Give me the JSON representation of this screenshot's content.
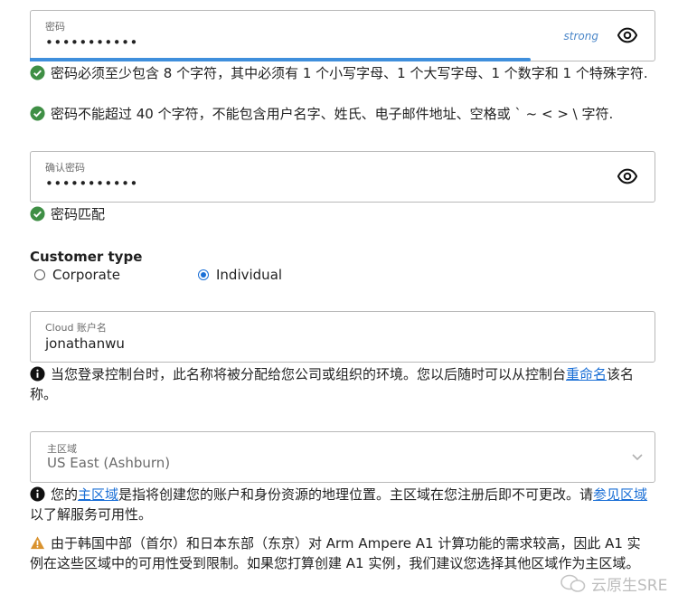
{
  "password": {
    "label": "密码",
    "value": "•••••••••••",
    "strength": "strong",
    "strength_fraction": 0.8,
    "rules": [
      "密码必须至少包含 8 个字符，其中必须有 1 个小写字母、1 个大写字母、1 个数字和 1 个特殊字符.",
      "密码不能超过 40 个字符，不能包含用户名字、姓氏、电子邮件地址、空格或 ` ~ < > \\ 字符."
    ]
  },
  "confirm_password": {
    "label": "确认密码",
    "value": "•••••••••••",
    "match_text": "密码匹配"
  },
  "customer_type": {
    "title": "Customer type",
    "options": [
      "Corporate",
      "Individual"
    ],
    "selected": "Individual"
  },
  "cloud_account": {
    "label": "Cloud 账户名",
    "value": "jonathanwu",
    "info_before": "当您登录控制台时，此名称将被分配给您公司或组织的环境。您以后随时可以从控制台",
    "info_link": "重命名",
    "info_after": "该名称。"
  },
  "home_region": {
    "label": "主区域",
    "value": "US East (Ashburn)",
    "info_p1": "您的",
    "info_link1": "主区域",
    "info_p2": "是指将创建您的账户和身份资源的地理位置。主区域在您注册后即不可更改。请",
    "info_link2": "参见区域",
    "info_p3": "以了解服务可用性。",
    "warning": "由于韩国中部（首尔）和日本东部（东京）对 Arm Ampere A1 计算功能的需求较高，因此 A1 实例在这些区域中的可用性受到限制。如果您打算创建 A1 实例，我们建议您选择其他区域作为主区域。"
  },
  "watermark": {
    "text": "云原生SRE"
  },
  "colors": {
    "accent": "#1a6fd6",
    "success": "#3f8f45",
    "warning": "#d9922e",
    "strength": "#3f8fdc"
  }
}
